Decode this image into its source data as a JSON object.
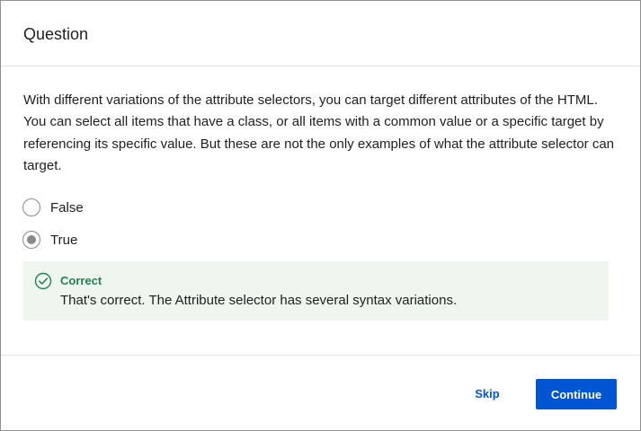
{
  "dialog": {
    "title": "Question"
  },
  "question": {
    "text": "With different variations of the attribute selectors, you can target different attributes of the HTML. You can select all items that have a class, or all items with a common value or a specific target by referencing its specific value. But these are not the only examples of what the attribute selector can target."
  },
  "options": [
    {
      "label": "False",
      "selected": false
    },
    {
      "label": "True",
      "selected": true
    }
  ],
  "feedback": {
    "status": "Correct",
    "message": "That's correct. The Attribute selector has several syntax variations.",
    "icon": "check-circle-icon",
    "status_color": "#1f8354",
    "background": "#eef6ef"
  },
  "footer": {
    "skip_label": "Skip",
    "continue_label": "Continue"
  },
  "colors": {
    "accent": "#0056d2"
  }
}
